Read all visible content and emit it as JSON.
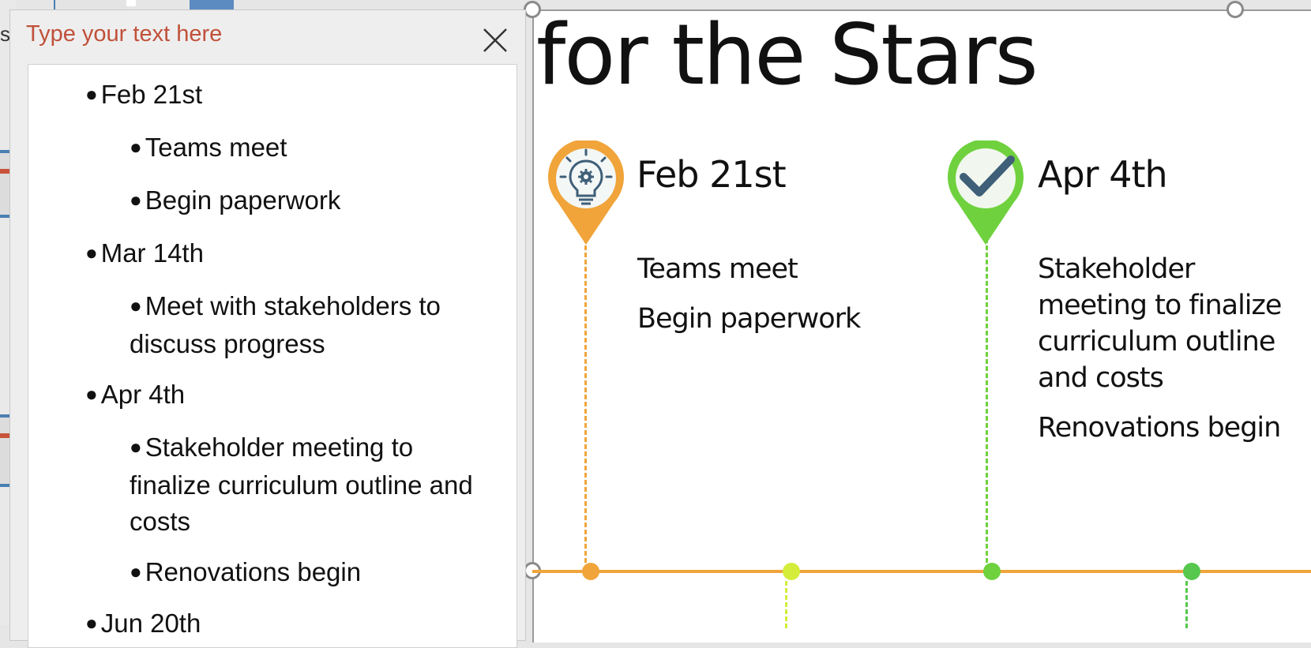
{
  "text_pane": {
    "title": "Type your text here",
    "close_icon": "close-icon",
    "items": [
      {
        "level": 1,
        "text": "Feb 21st"
      },
      {
        "level": 2,
        "text": "Teams meet"
      },
      {
        "level": 2,
        "text": "Begin paperwork"
      },
      {
        "level": 1,
        "text": "Mar 14th"
      },
      {
        "level": 2,
        "text": "Meet with stakeholders to discuss progress"
      },
      {
        "level": 1,
        "text": "Apr 4th"
      },
      {
        "level": 2,
        "text": "Stakeholder meeting to finalize curriculum outline and costs"
      },
      {
        "level": 2,
        "text": "Renovations begin"
      },
      {
        "level": 1,
        "text": "Jun 20th"
      }
    ]
  },
  "background": {
    "left_fragment_text": "s"
  },
  "slide": {
    "title": "for the Stars",
    "milestones": [
      {
        "date": "Feb 21st",
        "icon": "lightbulb-gear-icon",
        "color": "#f0a43a",
        "lines": [
          "Teams meet",
          "Begin paperwork"
        ]
      },
      {
        "date": "Apr 4th",
        "icon": "checkmark-icon",
        "color": "#6fd13e",
        "lines": [
          "Stakeholder meeting to finalize curriculum outline and costs",
          "Renovations begin"
        ]
      }
    ],
    "timeline_color": "#f0a43a",
    "dot_colors": [
      "#f0a43a",
      "#d4ec3a",
      "#6fd13e",
      "#57c84d"
    ]
  }
}
